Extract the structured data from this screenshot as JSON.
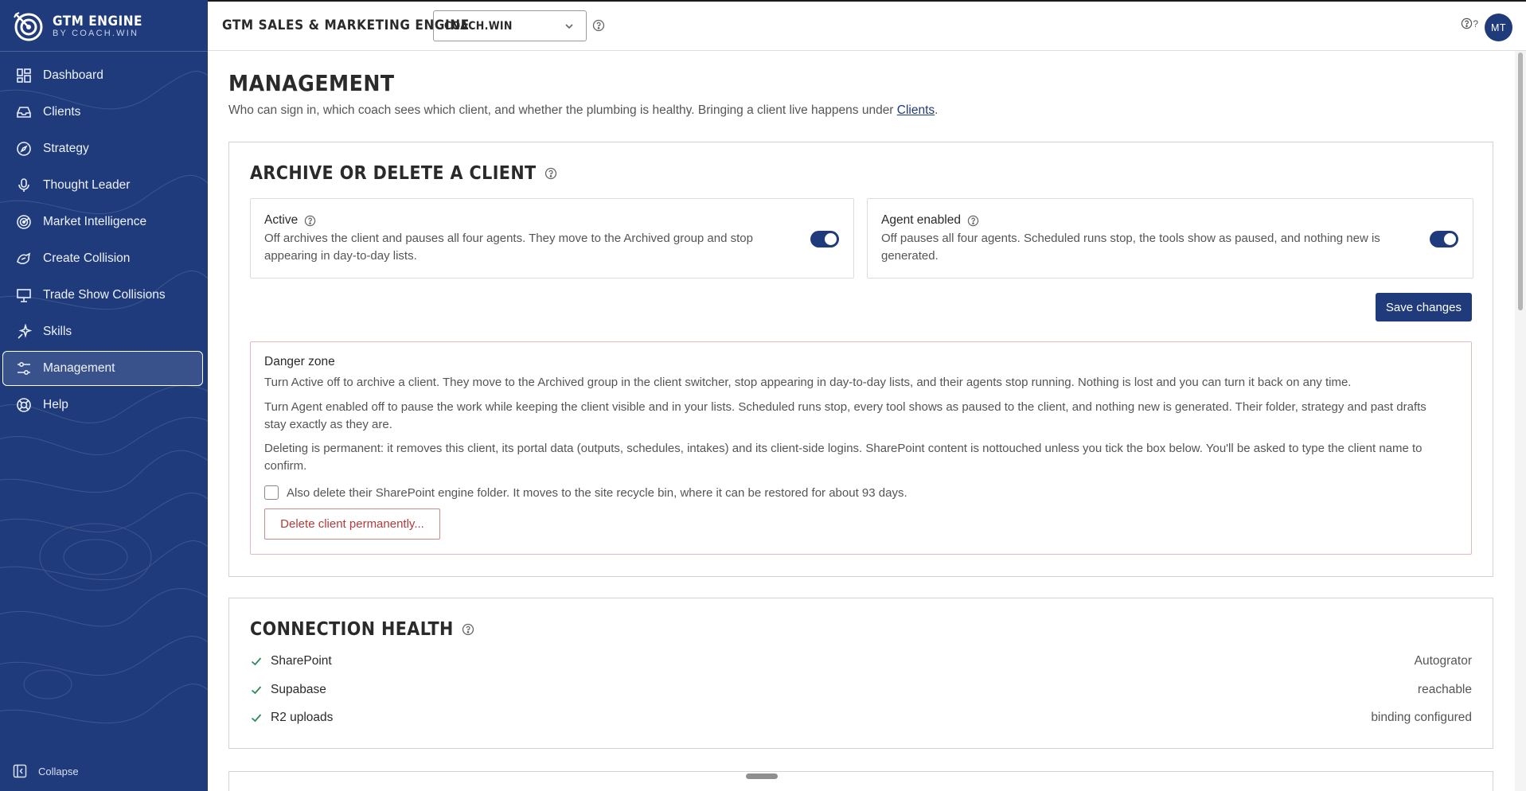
{
  "brand": {
    "name": "GTM ENGINE",
    "sub": "BY COACH.WIN"
  },
  "sidebar": {
    "items": [
      {
        "label": "Dashboard",
        "icon": "dashboard-icon"
      },
      {
        "label": "Clients",
        "icon": "inbox-icon"
      },
      {
        "label": "Strategy",
        "icon": "compass-icon"
      },
      {
        "label": "Thought Leader",
        "icon": "microphone-icon"
      },
      {
        "label": "Market Intelligence",
        "icon": "radar-icon"
      },
      {
        "label": "Create Collision",
        "icon": "collision-icon"
      },
      {
        "label": "Trade Show Collisions",
        "icon": "presentation-icon"
      },
      {
        "label": "Skills",
        "icon": "sparkles-icon"
      },
      {
        "label": "Management",
        "icon": "sliders-icon",
        "active": true
      },
      {
        "label": "Help",
        "icon": "lifebuoy-icon"
      }
    ],
    "collapse_label": "Collapse"
  },
  "header": {
    "title": "GTM SALES & MARKETING ENGINE",
    "client_select": "COACH.WIN",
    "help_badge": "?",
    "avatar_initials": "MT"
  },
  "page": {
    "title": "MANAGEMENT",
    "subtitle_prefix": "Who can sign in, which coach sees which client, and whether the plumbing is healthy. Bringing a client live happens under ",
    "subtitle_link": "Clients",
    "subtitle_suffix": "."
  },
  "archive": {
    "title": "ARCHIVE OR DELETE A CLIENT",
    "active": {
      "label": "Active",
      "desc_line1": "Off archives the client and pauses all four agents. They move to the Archived group and stop",
      "desc_line2": "appearing in day-to-day lists.",
      "on": true
    },
    "agent": {
      "label": "Agent enabled",
      "desc_line1": "Off pauses all four agents. Scheduled runs stop, the tools show as paused, and nothing new is",
      "desc_line2": "generated.",
      "on": true
    },
    "save_label": "Save changes",
    "danger": {
      "title": "Danger zone",
      "p1": "Turn Active off to archive a client. They move to the Archived group in the client switcher, stop appearing in day-to-day lists, and their agents stop running. Nothing is lost and you can turn it back on any time.",
      "p2_line1": "Turn Agent enabled off to pause the work while keeping the client visible and in your lists. Scheduled runs stop, every tool shows as paused to the client, and nothing new is generated. Their folder, strategy and past drafts",
      "p2_line2": "stay exactly as they are.",
      "p3_line1": "Deleting is permanent: it removes this client, its portal data (outputs, schedules, intakes) and its client-side logins. SharePoint content is nottouched unless you tick the box below. You'll be asked to type the client name to",
      "p3_line2": "confirm.",
      "checkbox_label": "Also delete their SharePoint engine folder. It moves to the site recycle bin, where it can be restored for about 93 days.",
      "delete_label": "Delete client permanently..."
    }
  },
  "health": {
    "title": "CONNECTION HEALTH",
    "rows": [
      {
        "name": "SharePoint",
        "value": "Autogrator"
      },
      {
        "name": "Supabase",
        "value": "reachable"
      },
      {
        "name": "R2 uploads",
        "value": "binding configured"
      }
    ]
  },
  "colors": {
    "brand": "#1f3b7b",
    "danger": "#b33a3a",
    "ok": "#2e8b57"
  }
}
